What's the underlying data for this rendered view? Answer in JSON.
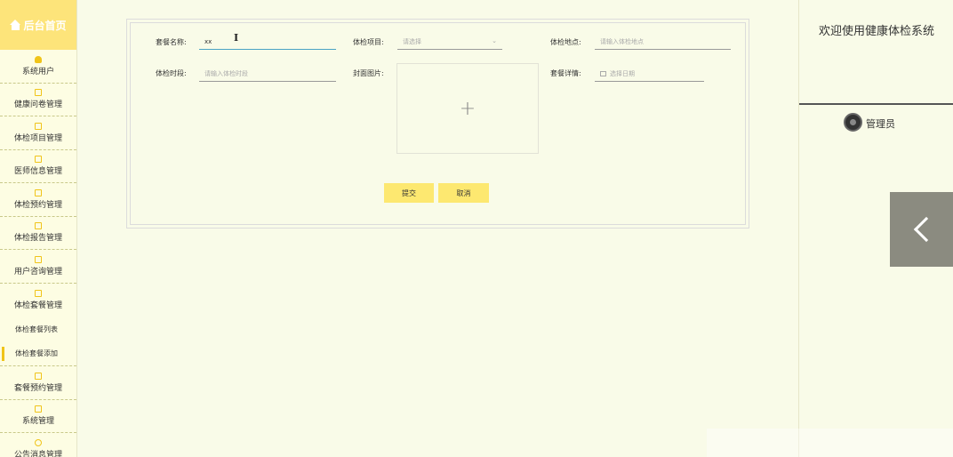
{
  "sidebar": {
    "home_label": "后台首页",
    "items": [
      {
        "label": "系统用户",
        "icon": "user-icon"
      },
      {
        "label": "健康问卷管理",
        "icon": "edit-icon"
      },
      {
        "label": "体检项目管理",
        "icon": "edit-icon"
      },
      {
        "label": "医师信息管理",
        "icon": "edit-icon"
      },
      {
        "label": "体检预约管理",
        "icon": "edit-icon"
      },
      {
        "label": "体检报告管理",
        "icon": "edit-icon"
      },
      {
        "label": "用户咨询管理",
        "icon": "edit-icon"
      },
      {
        "label": "体检套餐管理",
        "icon": "edit-icon"
      }
    ],
    "subitems": [
      {
        "label": "体检套餐列表",
        "active": false
      },
      {
        "label": "体检套餐添加",
        "active": true
      }
    ],
    "items_after": [
      {
        "label": "套餐预约管理",
        "icon": "edit-icon"
      },
      {
        "label": "系统管理",
        "icon": "settings-icon"
      },
      {
        "label": "公告消息管理",
        "icon": "info-icon"
      }
    ]
  },
  "form": {
    "name_label": "套餐名称:",
    "name_value": "xx",
    "project_label": "体检项目:",
    "project_placeholder": "请选择",
    "location_label": "体检地点:",
    "location_placeholder": "请输入体检地点",
    "time_label": "体检时段:",
    "time_placeholder": "请输入体检时段",
    "cover_label": "封面图片:",
    "upload_symbol": "+",
    "detail_label": "套餐详情:",
    "detail_placeholder": "选择日期",
    "submit_label": "提交",
    "cancel_label": "取消"
  },
  "right_panel": {
    "welcome": "欢迎使用健康体检系统",
    "admin_name": "管理员"
  },
  "colors": {
    "accent": "#fde47a",
    "background": "#f9fbe8",
    "button": "#fde870"
  }
}
